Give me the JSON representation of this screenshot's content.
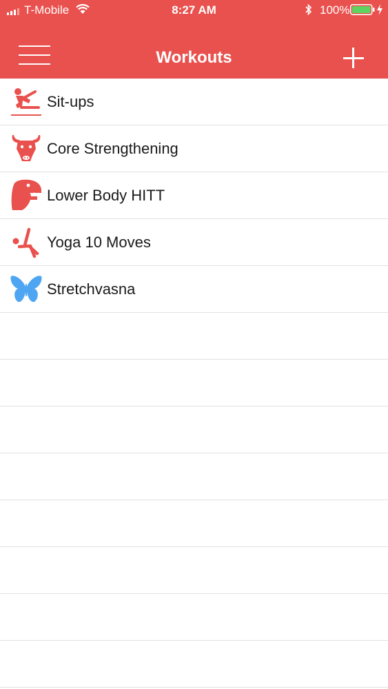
{
  "status_bar": {
    "carrier": "T-Mobile",
    "time": "8:27 AM",
    "battery_percent": "100%"
  },
  "nav": {
    "title": "Workouts"
  },
  "workouts": [
    {
      "label": "Sit-ups",
      "icon": "sit-ups-icon"
    },
    {
      "label": "Core Strengthening",
      "icon": "bull-icon"
    },
    {
      "label": "Lower Body HITT",
      "icon": "dinosaur-icon"
    },
    {
      "label": "Yoga 10 Moves",
      "icon": "yoga-pose-icon"
    },
    {
      "label": "Stretchvasna",
      "icon": "butterfly-icon"
    }
  ],
  "colors": {
    "header": "#e9514e",
    "icon_red": "#e9514e",
    "butterfly_blue": "#4ea6f2",
    "battery_green": "#5fd35f",
    "divider": "#e1e1e1"
  }
}
